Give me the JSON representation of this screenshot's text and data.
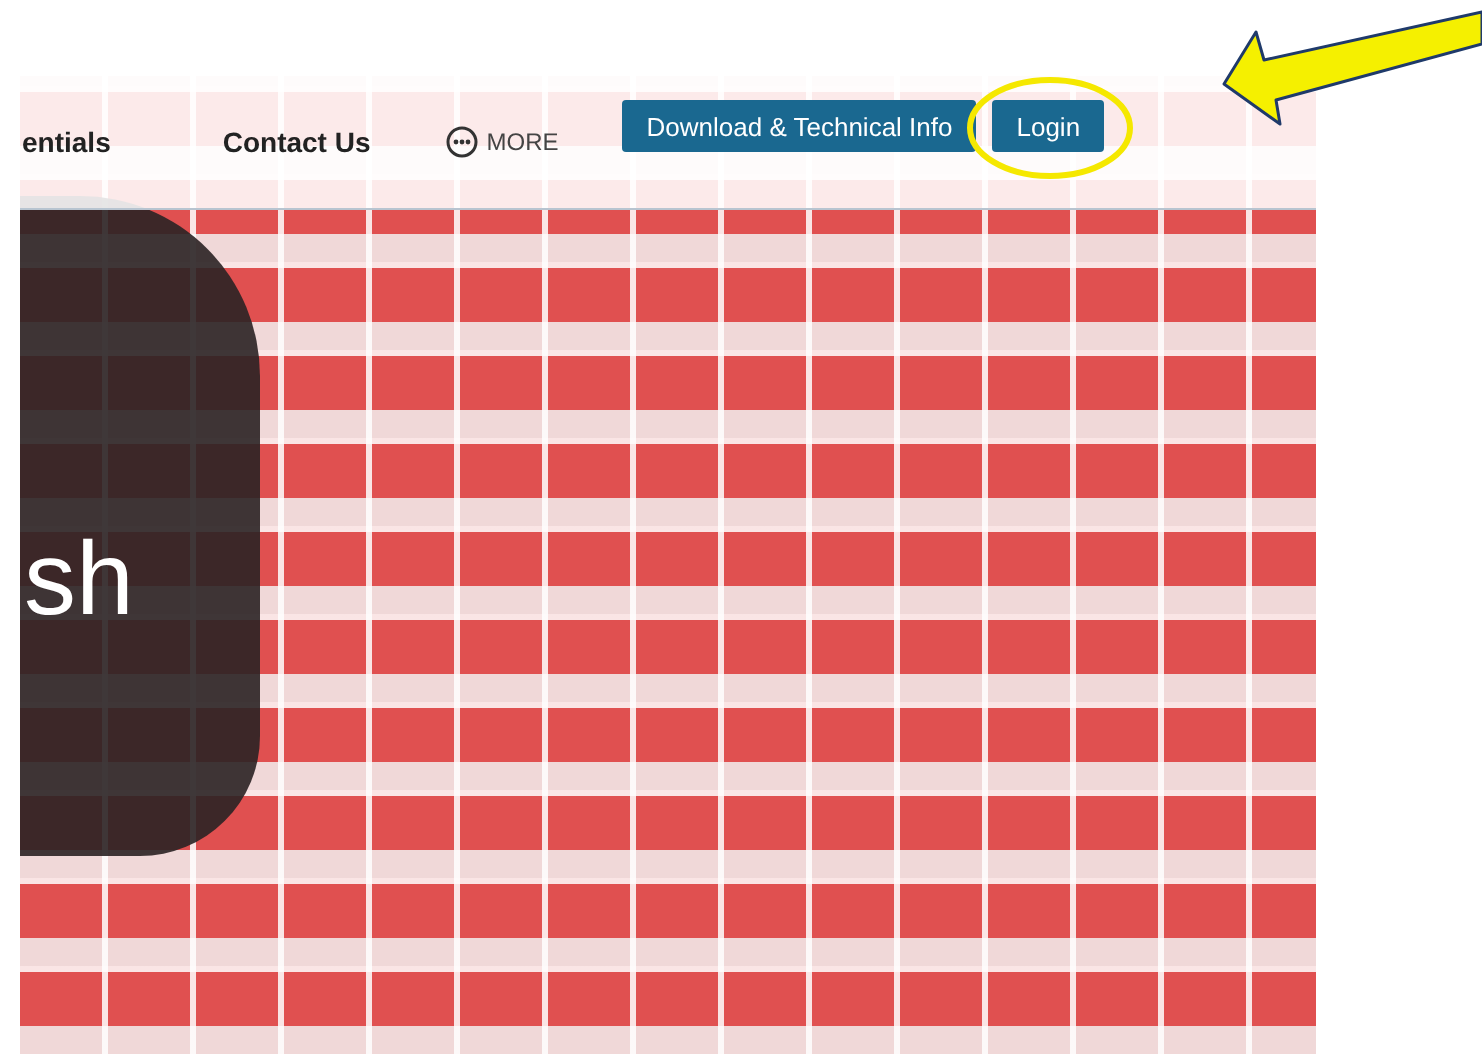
{
  "nav": {
    "items": [
      {
        "label": "entials"
      },
      {
        "label": "Contact Us"
      }
    ],
    "more": {
      "label": "MORE"
    }
  },
  "buttons": [
    {
      "label": "Download & Technical Info"
    },
    {
      "label": "Login"
    }
  ],
  "hero": {
    "text": "sh"
  }
}
